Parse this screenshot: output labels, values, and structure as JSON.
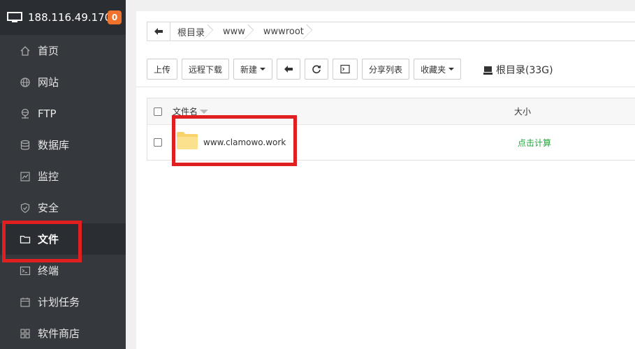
{
  "server": {
    "ip": "188.116.49.170",
    "badge": "0"
  },
  "nav": [
    {
      "label": "首页",
      "icon": "home-icon"
    },
    {
      "label": "网站",
      "icon": "globe-icon"
    },
    {
      "label": "FTP",
      "icon": "ftp-icon"
    },
    {
      "label": "数据库",
      "icon": "database-icon"
    },
    {
      "label": "监控",
      "icon": "monitor-chart-icon"
    },
    {
      "label": "安全",
      "icon": "shield-icon"
    },
    {
      "label": "文件",
      "icon": "folder-icon",
      "active": true
    },
    {
      "label": "终端",
      "icon": "terminal-icon"
    },
    {
      "label": "计划任务",
      "icon": "calendar-icon"
    },
    {
      "label": "软件商店",
      "icon": "apps-grid-icon"
    }
  ],
  "path": {
    "crumbs": [
      "根目录",
      "www",
      "wwwroot"
    ]
  },
  "toolbar": {
    "upload": "上传",
    "remote_download": "远程下载",
    "new": "新建",
    "share_list": "分享列表",
    "favorites": "收藏夹"
  },
  "disk": {
    "label": "根目录(33G)"
  },
  "table": {
    "headers": {
      "name": "文件名",
      "size": "大小"
    },
    "rows": [
      {
        "name": "www.clamowo.work",
        "size_action": "点击计算"
      }
    ]
  },
  "colors": {
    "sidebar_bg": "#35393d",
    "accent_green": "#20a53a",
    "badge": "#f0722d",
    "highlight": "#e02020"
  }
}
